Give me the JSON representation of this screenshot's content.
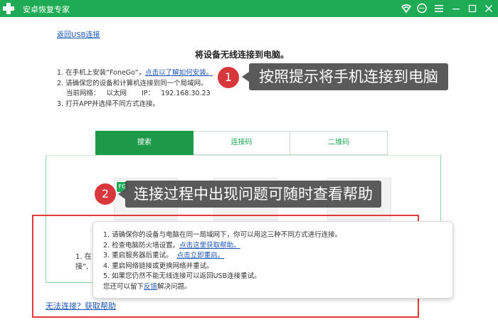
{
  "window": {
    "title": "安卓恢复专家",
    "controls": [
      "wifi-icon",
      "chat-icon",
      "menu-icon",
      "minimize-icon",
      "maximize-icon",
      "close-icon"
    ]
  },
  "back_link": "返回USB连接",
  "heading": "将设备无线连接到电脑。",
  "steps": {
    "s1_prefix": "1.  在手机上安装“FoneGo”，",
    "s1_link": "点击以了解如何安装。",
    "s2": "2.  请确保您的设备和计算机连接到同一个局域网。",
    "network_label": "当前网络：",
    "network_value": "以太网",
    "ip_label": "IP：",
    "ip_value": "192.168.30.23",
    "s3": "3.  打开APP并选择不同方式连接。"
  },
  "callouts": [
    {
      "number": "1",
      "text": "按照提示将手机连接到电脑"
    },
    {
      "number": "2",
      "text": "连接过程中出现问题可随时查看帮助"
    }
  ],
  "tabs": [
    {
      "label": "搜索",
      "active": true
    },
    {
      "label": "连接码",
      "active": false
    },
    {
      "label": "二维码",
      "active": false
    }
  ],
  "panel": {
    "logo_text": "FG",
    "partial_1": "1. 在",
    "partial_2": "接”,"
  },
  "help": {
    "l1": "1.  请确保你的设备与电脑在同一局域网下，你可以用这三种不同方式进行连接。",
    "l2_prefix": "2.  检查电脑防火墙设置。",
    "l2_link": "点击这里获取帮助。",
    "l3_prefix": "3.  重启服务器后重试。",
    "l3_link": "点击立即重启。",
    "l4": "4.  重启网络链接或更换网络并重试。",
    "l5": "5.  如果您仍然不能无线连接可以返回USB连接重试。",
    "l6_prefix": "您还可以留下",
    "l6_link": "反馈",
    "l6_suffix": "解决问题。"
  },
  "cant_connect": "无法连接？获取帮助",
  "colors": {
    "accent_green": "#1fab55",
    "link_blue": "#1a56b8",
    "callout_red": "#d8373c",
    "frame_red": "#e03a3a"
  }
}
